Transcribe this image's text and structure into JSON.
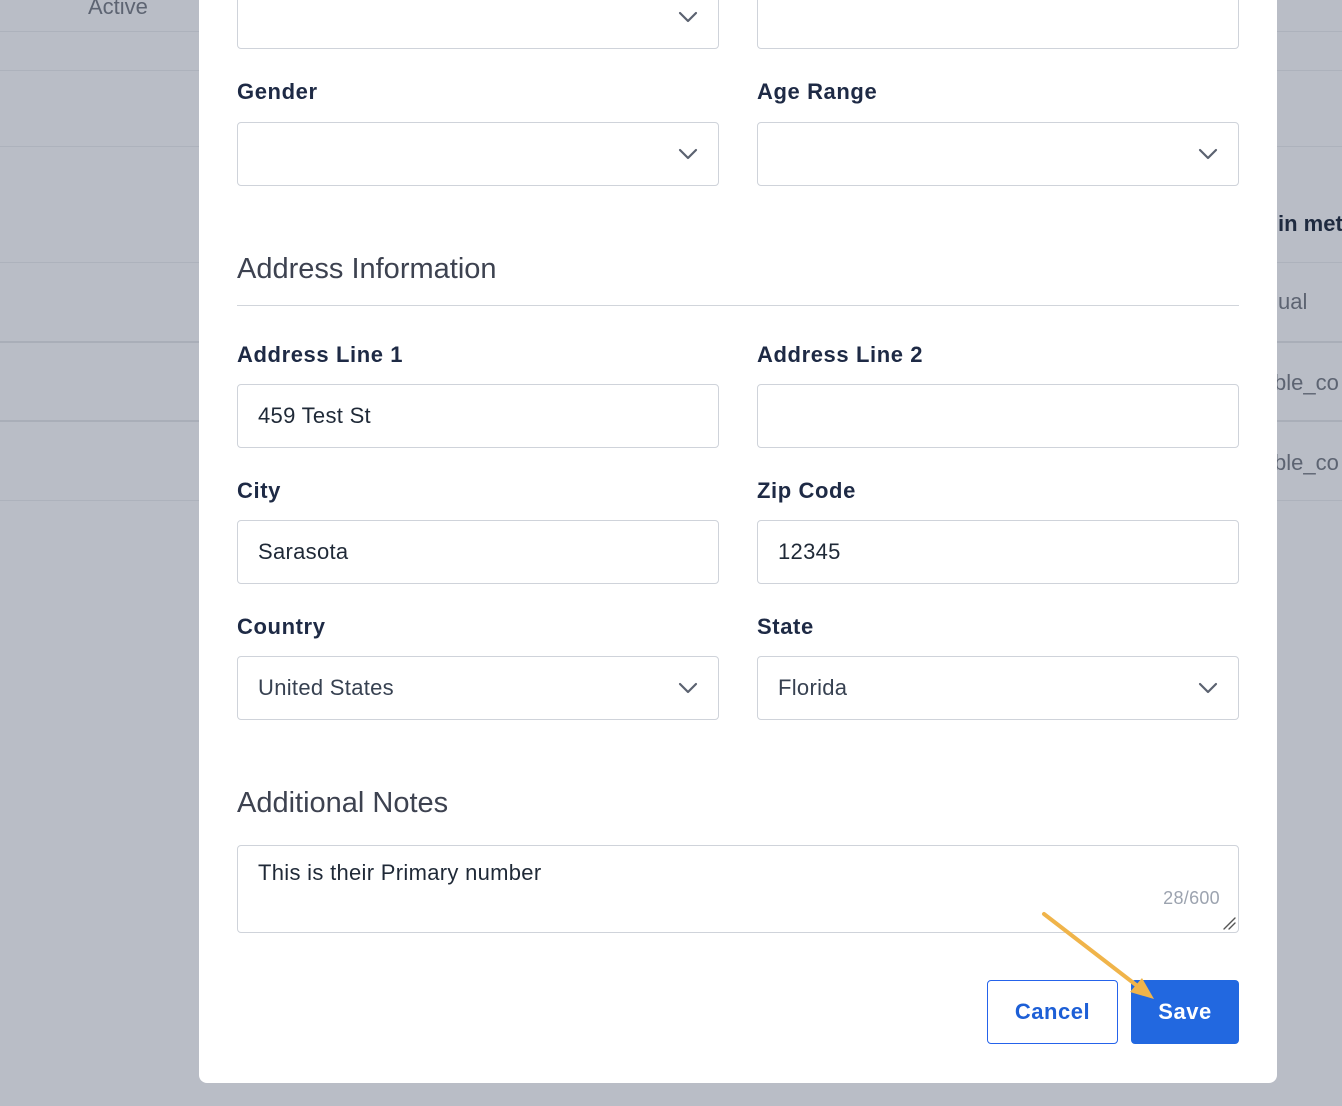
{
  "background": {
    "status_text": "Active",
    "column_header_fragment": "in met",
    "row_fragments": [
      "ual",
      "ble_co",
      "ble_co"
    ]
  },
  "form": {
    "top_select": {
      "value": ""
    },
    "top_input": {
      "value": ""
    },
    "gender": {
      "label": "Gender",
      "value": ""
    },
    "age_range": {
      "label": "Age Range",
      "value": ""
    },
    "address_section_title": "Address Information",
    "address_line1": {
      "label": "Address Line 1",
      "value": "459 Test St"
    },
    "address_line2": {
      "label": "Address Line 2",
      "value": ""
    },
    "city": {
      "label": "City",
      "value": "Sarasota"
    },
    "zip": {
      "label": "Zip Code",
      "value": "12345"
    },
    "country": {
      "label": "Country",
      "value": "United States"
    },
    "state": {
      "label": "State",
      "value": "Florida"
    },
    "notes_section_title": "Additional Notes",
    "notes": {
      "value": "This is their Primary number",
      "counter": "28/600"
    }
  },
  "actions": {
    "cancel_label": "Cancel",
    "save_label": "Save"
  },
  "colors": {
    "primary": "#2268e0",
    "annotation_arrow": "#f0b44a",
    "overlay": "#b9bdc6"
  },
  "icons": {
    "select_chevron": "chevron-down-icon",
    "annotation": "arrow-pointer-icon"
  }
}
